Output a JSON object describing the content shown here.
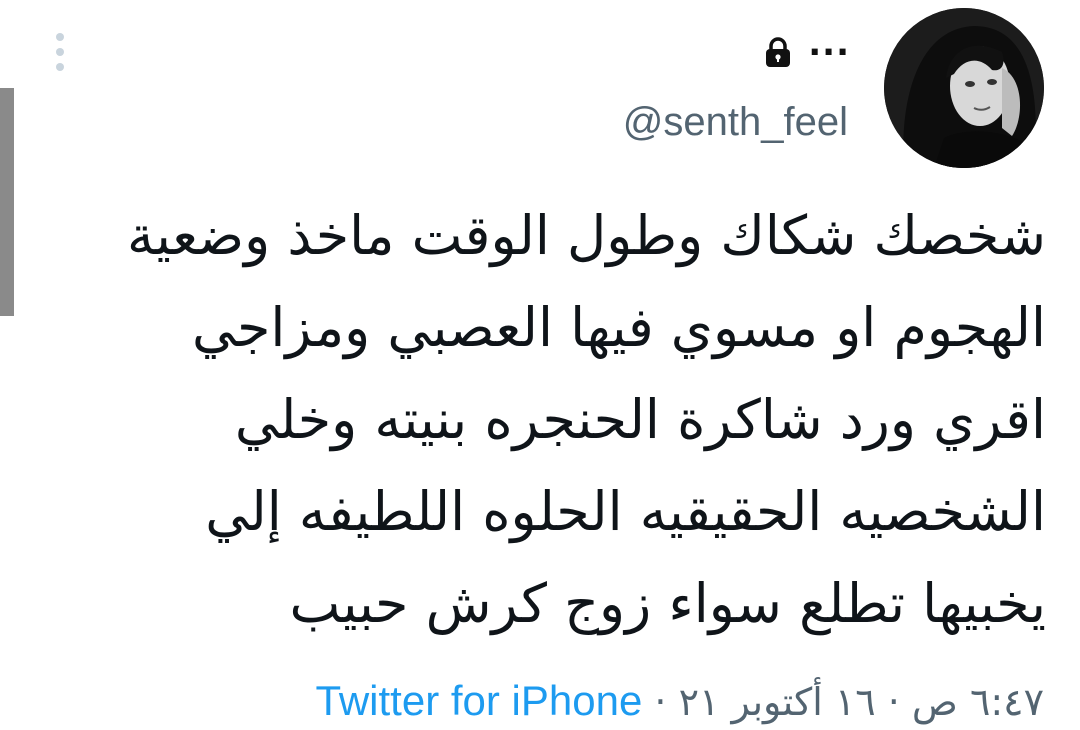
{
  "tweet": {
    "username": "@senth_feel",
    "more_label": "...",
    "text": "شخصك شكاك وطول الوقت ماخذ وضعية\nالهجوم او مسوي فيها العصبي ومزاجي\nاقري ورد شاكرة الحنجره بنيته  وخلي\nالشخصيه الحقيقيه الحلوه اللطيفه إلي\nيخبيها تطلع سواء زوج كرش حبيب",
    "timestamp": "٦:٤٧ ص · ١٦ أكتوبر ٢١ ·",
    "source": "Twitter for iPhone"
  },
  "icons": {
    "lock": "lock-icon",
    "more": "more-horizontal-icon",
    "vertical_dots": "more-vertical-icon"
  },
  "colors": {
    "text": "#0f1419",
    "secondary": "#536471",
    "link": "#1d9bf0"
  }
}
